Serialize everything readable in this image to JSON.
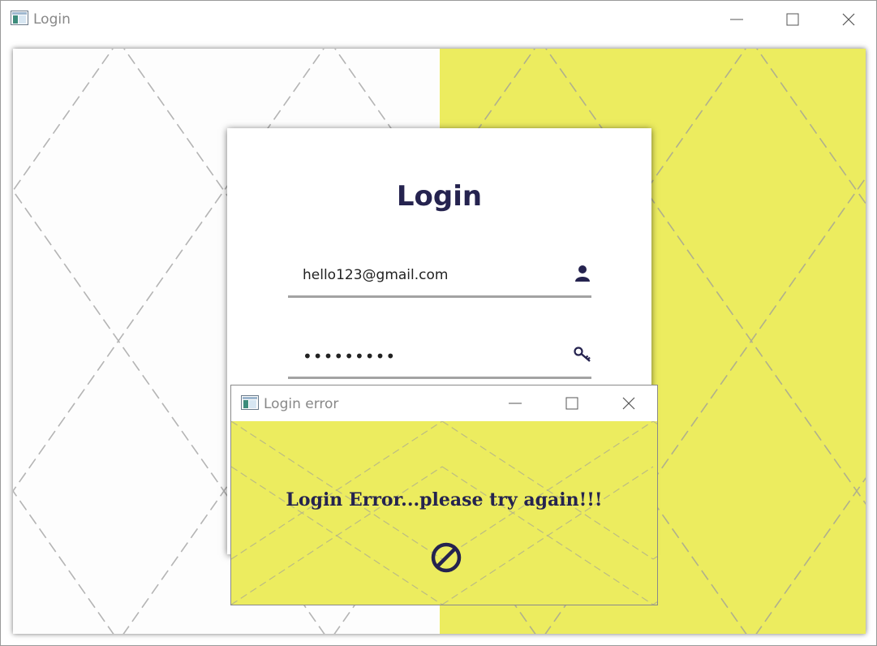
{
  "window": {
    "title": "Login",
    "icon": "app-window-icon",
    "controls": [
      "minimize-icon",
      "maximize-icon",
      "close-icon"
    ]
  },
  "colors": {
    "accent_yellow": "#ecec5f",
    "navy": "#25234f",
    "underline_gray": "#a3a3a3"
  },
  "login_card": {
    "heading": "Login",
    "email": {
      "value": "hello123@gmail.com",
      "icon": "user-icon"
    },
    "password": {
      "value": "•••••••••",
      "icon": "key-icon"
    }
  },
  "error_dialog": {
    "title": "Login error",
    "message": "Login Error...please try again!!!",
    "icon": "prohibited-icon"
  }
}
